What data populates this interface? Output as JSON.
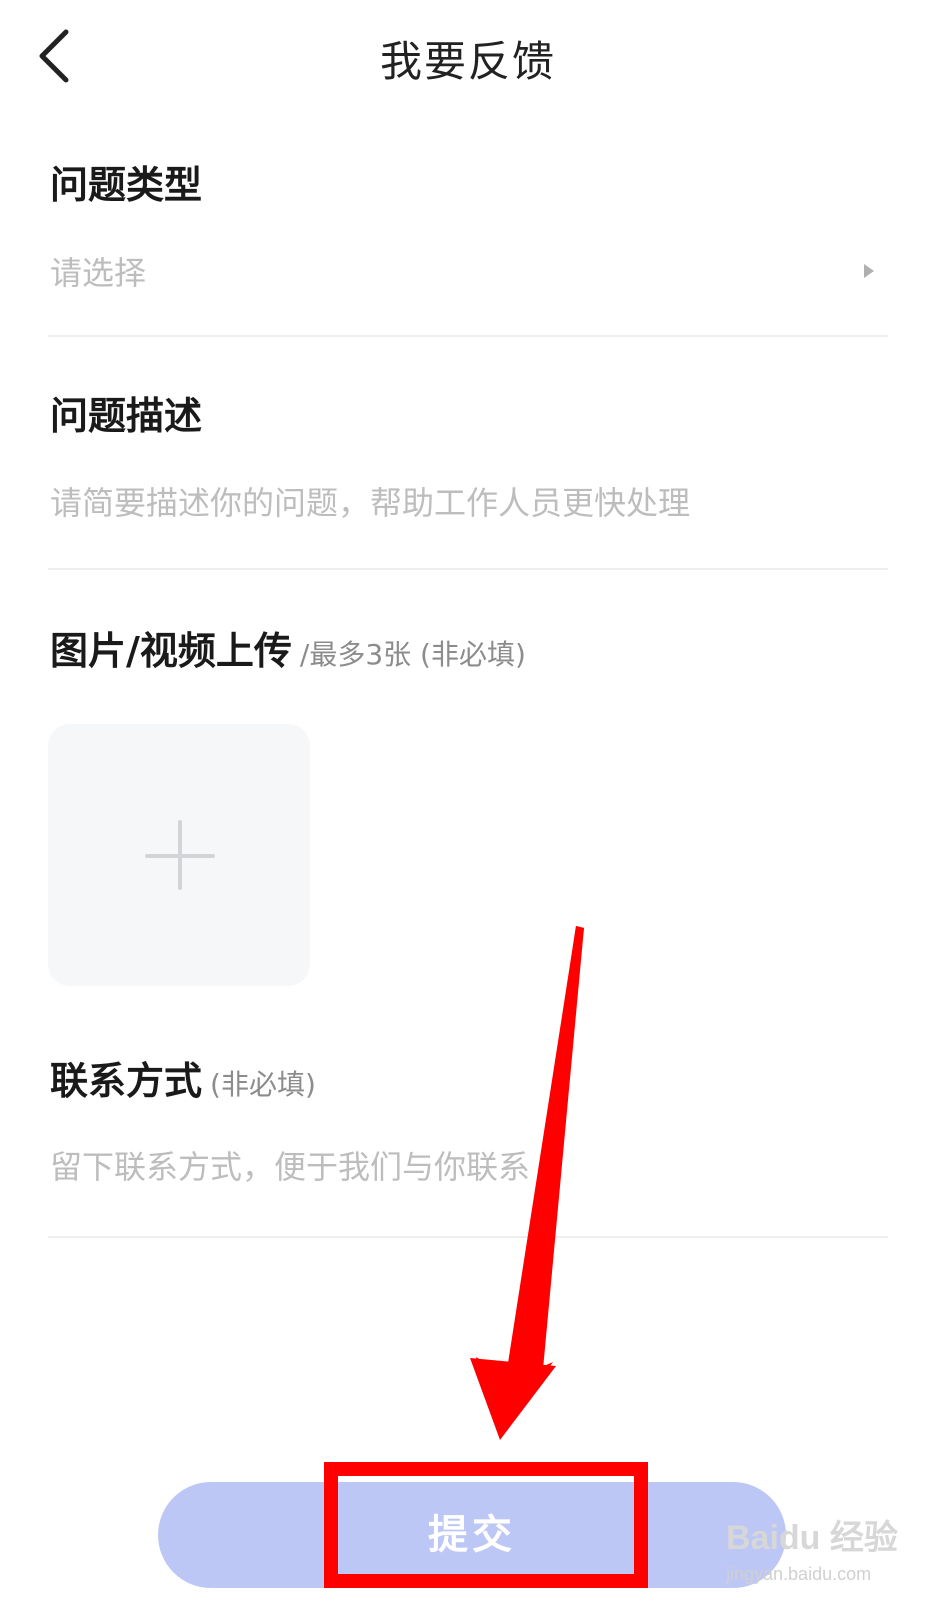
{
  "header": {
    "title": "我要反馈",
    "back_icon": "chevron-left-icon"
  },
  "issue_type": {
    "label": "问题类型",
    "placeholder": "请选择",
    "arrow_icon": "triangle-right-icon"
  },
  "issue_description": {
    "label": "问题描述",
    "placeholder": "请简要描述你的问题，帮助工作人员更快处理"
  },
  "media_upload": {
    "label": "图片/视频上传",
    "hint": "/最多3张 (非必填)",
    "add_icon": "plus-icon"
  },
  "contact": {
    "label": "联系方式",
    "hint": "(非必填)",
    "placeholder": "留下联系方式，便于我们与你联系"
  },
  "submit": {
    "label": "提交"
  },
  "annotation": {
    "color": "#ff0000",
    "arrow_icon": "red-arrow-icon"
  },
  "watermark": {
    "main": "Baidu 经验",
    "sub": "jingyan.baidu.com"
  },
  "colors": {
    "accent": "#bdc7f6",
    "placeholder": "#bdbdbd"
  }
}
